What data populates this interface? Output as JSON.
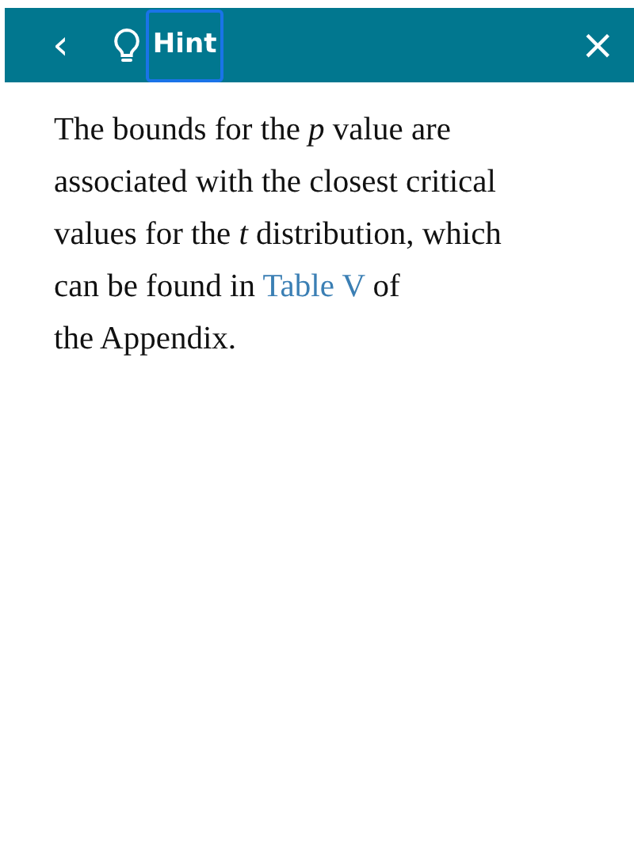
{
  "header": {
    "back": "‹",
    "title": "Hint",
    "title_focused": true,
    "close": "×"
  },
  "hint": {
    "text_before": "The bounds for the *p* value are associated with the closest critical values for the *t* distribution, which can be found in ",
    "link": "Table V",
    "text_after": " of\nthe Appendix."
  }
}
